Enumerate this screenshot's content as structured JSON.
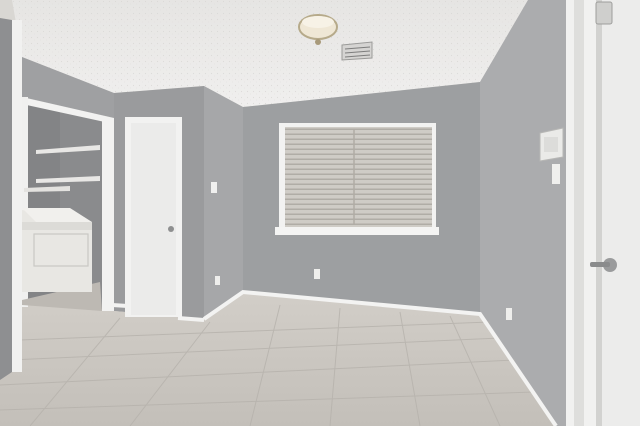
{
  "scene": {
    "kind": "empty-room-interior",
    "colors": {
      "ceiling": "#ecebea",
      "wall_back": "#9c9ea0",
      "wall_left": "#a4a5a7",
      "wall_right": "#a9aaac",
      "wall_near_left": "#8f9092",
      "trim": "#f2f2f1",
      "door": "#eeeeed",
      "floor": "#c9c5bf",
      "grout": "#b8b4ae",
      "closet_interior": "#8c8d8f",
      "window_glass": "#cfcdc9",
      "blind_slat": "#bdb9b3",
      "washer": "#e7e6e2"
    },
    "objects": [
      {
        "name": "ceiling-light-fixture",
        "icon": "ceiling-light-icon"
      },
      {
        "name": "ceiling-air-vent",
        "icon": "vent-icon"
      },
      {
        "name": "window-with-blinds",
        "icon": "window-icon"
      },
      {
        "name": "closet-door",
        "icon": "door-icon"
      },
      {
        "name": "laundry-closet",
        "icon": "washer-icon"
      },
      {
        "name": "entry-door",
        "icon": "door-icon"
      },
      {
        "name": "thermostat",
        "icon": "thermostat-icon"
      },
      {
        "name": "light-switch",
        "icon": "switch-icon"
      },
      {
        "name": "wall-outlet",
        "icon": "outlet-icon"
      },
      {
        "name": "tile-floor",
        "icon": "floor-tile-icon"
      }
    ]
  }
}
